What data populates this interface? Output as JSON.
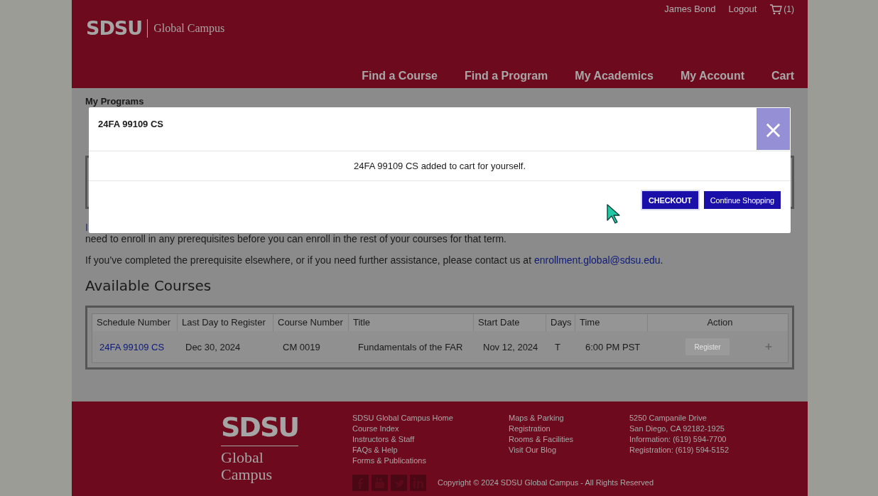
{
  "header": {
    "logo_text": "SDSU",
    "logo_subtitle": "Global Campus",
    "user_links": [
      {
        "label": "James Bond"
      },
      {
        "label": "Logout"
      }
    ],
    "cart_count": "(1)",
    "nav": [
      {
        "label": "Find a Course"
      },
      {
        "label": "Find a Program"
      },
      {
        "label": "My Academics"
      },
      {
        "label": "My Account"
      },
      {
        "label": "Cart"
      }
    ]
  },
  "content": {
    "breadcrumb": "My Programs",
    "paragraph_fragment": "I",
    "paragraphs": [
      "need to enroll in any prerequisites before you can enroll in the rest of your courses for that term."
    ],
    "contact_text": "If you’ve completed the prerequisite elsewhere, or if you need further assistance, please contact us at ",
    "contact_email": "enrollment.global@sdsu.edu",
    "contact_end": ".",
    "section_title": "Available Courses",
    "table": {
      "columns": [
        "Schedule Number",
        "Last Day to Register",
        "Course Number",
        "Title",
        "Start Date",
        "Days",
        "Time",
        "Action"
      ],
      "rows": [
        {
          "schedule_number": "24FA 99109 CS",
          "last_day": "Dec 30, 2024",
          "course_number": "CM 0019",
          "title": "Fundamentals of the FAR",
          "start_date": "Nov 12, 2024",
          "days": "T",
          "time": "6:00 PM PST",
          "action": "Register",
          "action_disabled": true,
          "expand": "+"
        }
      ]
    }
  },
  "modal": {
    "title": "24FA 99109 CS",
    "close": "×",
    "message": "24FA 99109 CS added to cart for yourself.",
    "buttons": [
      {
        "label": "CHECKOUT",
        "focused": true
      },
      {
        "label": "Continue Shopping",
        "focused": false
      }
    ]
  },
  "footer": {
    "logo_text": "SDSU",
    "logo_lines": [
      "Global",
      "Campus"
    ],
    "link_columns": [
      [
        "SDSU Global Campus Home",
        "Course Index",
        "Instructors & Staff",
        "FAQs & Help",
        "Forms & Publications"
      ],
      [
        "Maps & Parking",
        "Registration",
        "Rooms & Facilities",
        "Visit Our Blog"
      ]
    ],
    "address": [
      "5250 Campanile Drive",
      "San Diego, CA 92182-1925",
      "Information: (619) 594-7700",
      "Registration: (619) 594-5152"
    ],
    "social": [
      {
        "kind": "facebook"
      },
      {
        "kind": "youtube"
      },
      {
        "kind": "twitter"
      },
      {
        "kind": "linkedin"
      }
    ],
    "copyright": "Copyright © 2024 SDSU Global Campus - All Rights Reserved"
  }
}
